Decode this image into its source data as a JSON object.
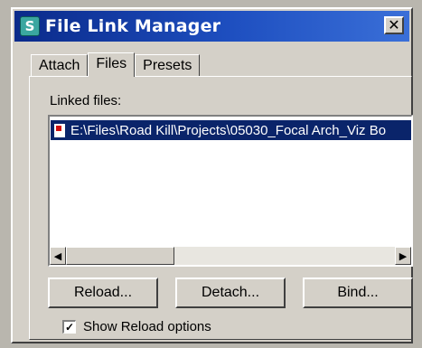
{
  "window": {
    "title": "File Link Manager",
    "close_glyph": "✕"
  },
  "tabs": [
    {
      "label": "Attach",
      "active": false
    },
    {
      "label": "Files",
      "active": true
    },
    {
      "label": "Presets",
      "active": false
    }
  ],
  "files_panel": {
    "linked_label": "Linked files:",
    "linked_files": [
      {
        "path": "E:\\Files\\Road Kill\\Projects\\05030_Focal Arch_Viz Bo",
        "selected": true,
        "icon": "file-icon"
      }
    ],
    "scroll_left": "◀",
    "scroll_right": "▶"
  },
  "buttons": {
    "reload": "Reload...",
    "detach": "Detach...",
    "bind": "Bind..."
  },
  "options": {
    "show_reload_label": "Show Reload options",
    "show_reload_checked": true,
    "check_glyph": "✓"
  },
  "colors": {
    "titlebar": "#0a246a",
    "selection": "#0a246a",
    "face": "#d4d0c8"
  }
}
